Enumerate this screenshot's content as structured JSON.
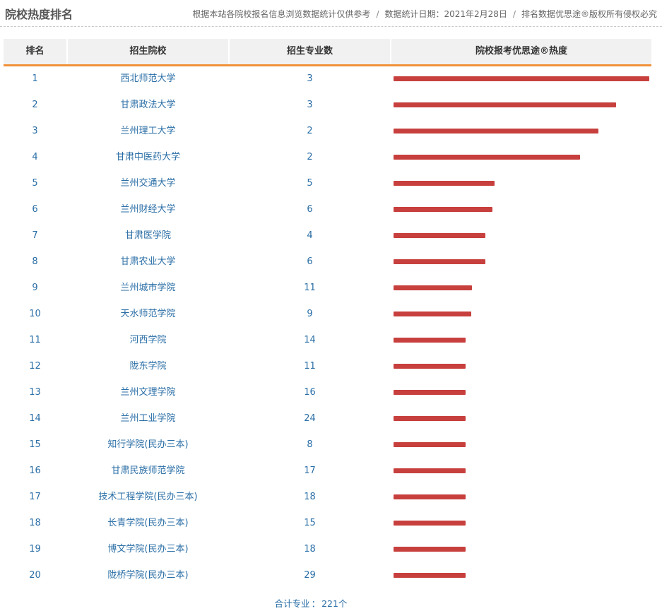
{
  "header": {
    "title": "院校热度排名",
    "note_parts": [
      "根据本站各院校报名信息浏览数据统计仅供参考",
      "数据统计日期：2021年2月28日",
      "排名数据优思途®版权所有侵权必究"
    ],
    "separator": "/"
  },
  "table": {
    "columns": [
      "排名",
      "招生院校",
      "招生专业数",
      "院校报考优思途®热度"
    ]
  },
  "chart_data": {
    "type": "bar",
    "orientation": "horizontal",
    "title": "院校报考优思途®热度",
    "axis_visible": false,
    "rows": [
      {
        "rank": "1",
        "school": "西北师范大学",
        "majors": "3",
        "heat": 100
      },
      {
        "rank": "2",
        "school": "甘肃政法大学",
        "majors": "3",
        "heat": 87
      },
      {
        "rank": "3",
        "school": "兰州理工大学",
        "majors": "2",
        "heat": 80
      },
      {
        "rank": "4",
        "school": "甘肃中医药大学",
        "majors": "2",
        "heat": 73
      },
      {
        "rank": "5",
        "school": "兰州交通大学",
        "majors": "5",
        "heat": 39.5
      },
      {
        "rank": "6",
        "school": "兰州财经大学",
        "majors": "6",
        "heat": 38.7
      },
      {
        "rank": "7",
        "school": "甘肃医学院",
        "majors": "4",
        "heat": 36
      },
      {
        "rank": "8",
        "school": "甘肃农业大学",
        "majors": "6",
        "heat": 36
      },
      {
        "rank": "9",
        "school": "兰州城市学院",
        "majors": "11",
        "heat": 30.7
      },
      {
        "rank": "10",
        "school": "天水师范学院",
        "majors": "9",
        "heat": 30.4
      },
      {
        "rank": "11",
        "school": "河西学院",
        "majors": "14",
        "heat": 28.2
      },
      {
        "rank": "12",
        "school": "陇东学院",
        "majors": "11",
        "heat": 28.2
      },
      {
        "rank": "13",
        "school": "兰州文理学院",
        "majors": "16",
        "heat": 28.2
      },
      {
        "rank": "14",
        "school": "兰州工业学院",
        "majors": "24",
        "heat": 28.2
      },
      {
        "rank": "15",
        "school": "知行学院(民办三本)",
        "majors": "8",
        "heat": 28.2
      },
      {
        "rank": "16",
        "school": "甘肃民族师范学院",
        "majors": "17",
        "heat": 28.2
      },
      {
        "rank": "17",
        "school": "技术工程学院(民办三本)",
        "majors": "18",
        "heat": 28.2
      },
      {
        "rank": "18",
        "school": "长青学院(民办三本)",
        "majors": "15",
        "heat": 28.2
      },
      {
        "rank": "19",
        "school": "博文学院(民办三本)",
        "majors": "18",
        "heat": 28.2
      },
      {
        "rank": "20",
        "school": "陇桥学院(民办三本)",
        "majors": "29",
        "heat": 28.2
      }
    ],
    "bar_color": "#c7403d"
  },
  "footer": {
    "label": "合计专业",
    "value": "221个"
  },
  "colors": {
    "accent_line": "#f0923a",
    "text_link": "#2a6ea6",
    "header_bg": "#f1f1f1"
  }
}
